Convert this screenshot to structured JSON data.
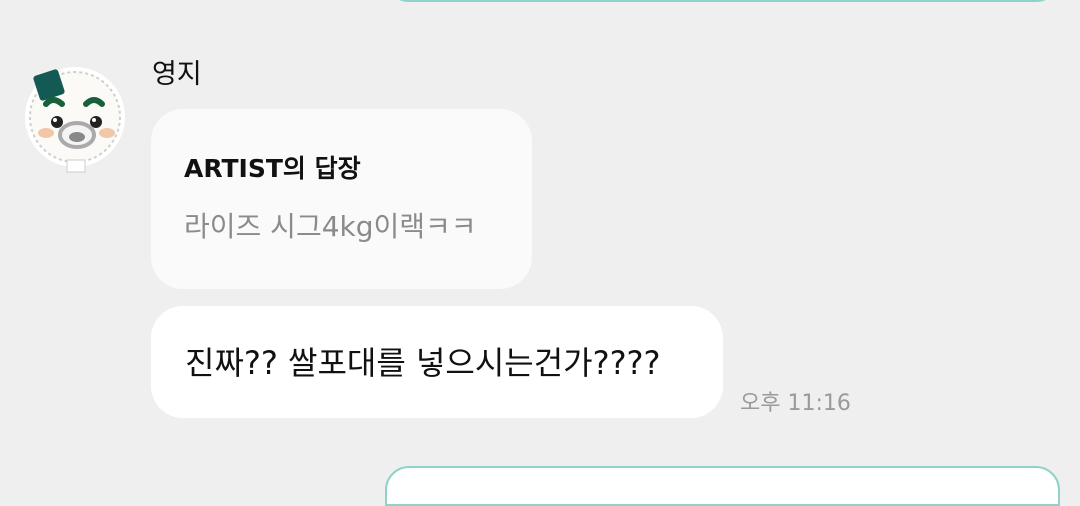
{
  "conversation": {
    "sender": {
      "name": "영지",
      "avatar_icon": "rice-ball-character-avatar"
    },
    "message": {
      "reply": {
        "header": "ARTIST의 답장",
        "quoted_text": "라이즈 시그4kg이랙ㅋㅋ"
      },
      "text": "진짜?? 쌀포대를 넣으시는건가????",
      "time": "오후 11:16"
    }
  },
  "colors": {
    "background": "#efefef",
    "bubble": "#ffffff",
    "sent_bubble_border": "#8fd3c6",
    "avatar_accent": "#145a54"
  }
}
